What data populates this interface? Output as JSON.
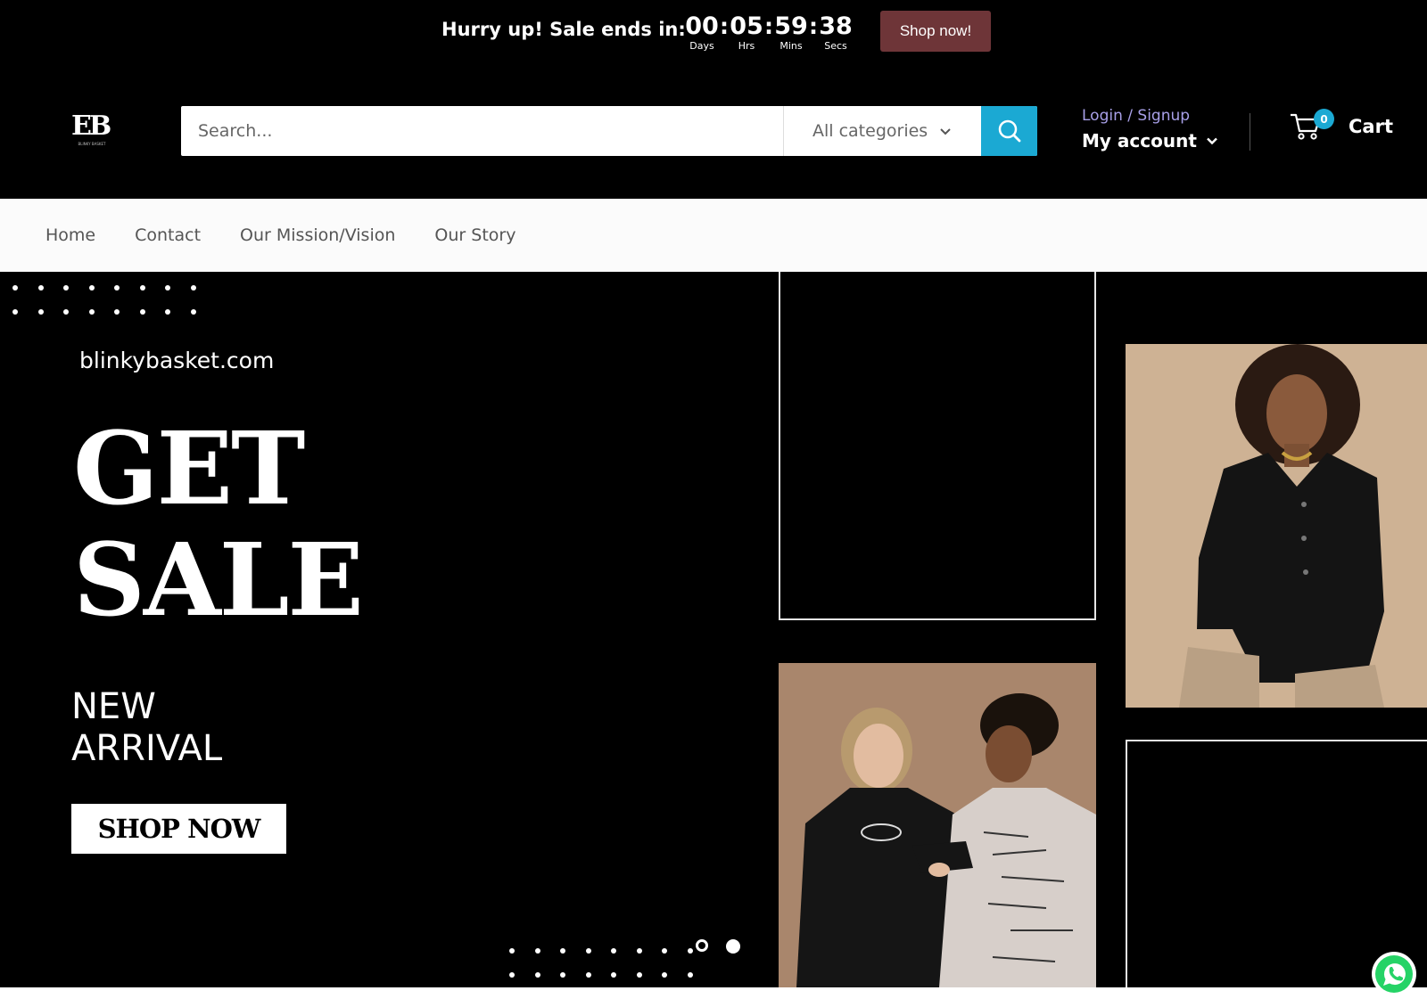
{
  "announcement": {
    "message": "Hurry up! Sale ends in:",
    "countdown": [
      {
        "value": "00",
        "unit": "Days"
      },
      {
        "value": "05",
        "unit": "Hrs"
      },
      {
        "value": "59",
        "unit": "Mins"
      },
      {
        "value": "38",
        "unit": "Secs"
      }
    ],
    "separator": ":",
    "cta_label": "Shop now!"
  },
  "header": {
    "logo_text": "EB",
    "logo_subtext": "BLINKY BASKET",
    "search": {
      "placeholder": "Search...",
      "value": "",
      "category": "All categories",
      "icon": "search-icon"
    },
    "account": {
      "login_label": "Login / Signup",
      "account_label": "My account"
    },
    "cart": {
      "label": "Cart",
      "count": "0",
      "icon": "cart-icon"
    }
  },
  "nav": {
    "items": [
      {
        "label": "Home"
      },
      {
        "label": "Contact"
      },
      {
        "label": "Our Mission/Vision"
      },
      {
        "label": "Our Story"
      }
    ]
  },
  "hero": {
    "site": "blinkybasket.com",
    "headline_1": "GET",
    "headline_2": "SALE",
    "sub_1": "NEW",
    "sub_2": "ARRIVAL",
    "cta_label": "SHOP NOW",
    "slides": 2,
    "active_slide": 2
  },
  "colors": {
    "background": "#000000",
    "accent_blue": "#1ba9d3",
    "sale_button": "#6e3538",
    "login_link": "#a8a0e8"
  },
  "widgets": {
    "chat_icon": "whatsapp-icon"
  }
}
